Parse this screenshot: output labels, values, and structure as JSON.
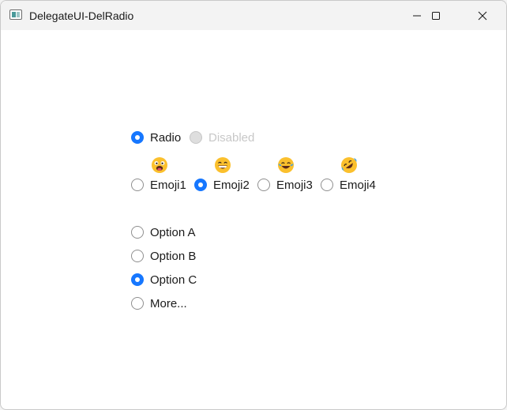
{
  "window": {
    "title": "DelegateUI-DelRadio",
    "controls": [
      "minimize-icon",
      "maximize-icon",
      "close-icon"
    ]
  },
  "top_radios": [
    {
      "label": "Radio",
      "checked": true,
      "disabled": false
    },
    {
      "label": "Disabled",
      "checked": false,
      "disabled": true
    }
  ],
  "emoji_radios": [
    {
      "label": "Emoji1",
      "icon": "silly-face-emoji",
      "checked": false
    },
    {
      "label": "Emoji2",
      "icon": "grinning-face-emoji",
      "checked": true
    },
    {
      "label": "Emoji3",
      "icon": "tears-of-joy-emoji",
      "checked": false
    },
    {
      "label": "Emoji4",
      "icon": "rolling-laughing-emoji",
      "checked": false
    }
  ],
  "option_radios": [
    {
      "label": "Option A",
      "checked": false
    },
    {
      "label": "Option B",
      "checked": false
    },
    {
      "label": "Option C",
      "checked": true
    },
    {
      "label": "More...",
      "checked": false
    }
  ],
  "colors": {
    "accent": "#1677ff",
    "emoji_yellow": "#fbc02d"
  }
}
